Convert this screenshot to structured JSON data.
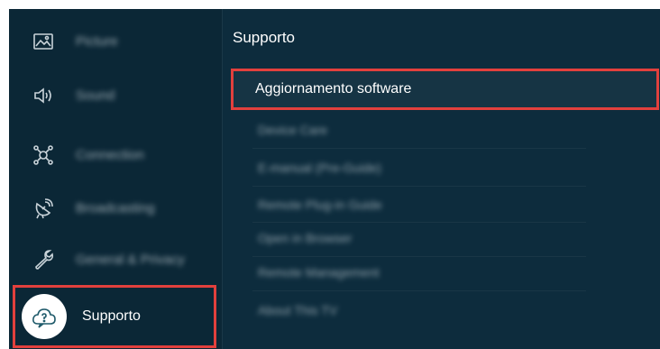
{
  "sidebar": {
    "items": [
      {
        "label": "Picture",
        "icon": "picture-icon"
      },
      {
        "label": "Sound",
        "icon": "speaker-icon"
      },
      {
        "label": "Connection",
        "icon": "network-icon"
      },
      {
        "label": "Broadcasting",
        "icon": "satellite-icon"
      },
      {
        "label": "General & Privacy",
        "icon": "wrench-icon"
      },
      {
        "label": "Supporto",
        "icon": "support-cloud-icon"
      }
    ],
    "selected_index": 5
  },
  "panel": {
    "title": "Supporto",
    "highlighted": "Aggiornamento software",
    "items": [
      {
        "label": "Device Care"
      },
      {
        "label": "E-manual (Pre-Guide)"
      },
      {
        "label": "Remote Plug-in Guide"
      },
      {
        "label": "Open in Browser"
      },
      {
        "label": "Remote Management"
      },
      {
        "label": "About This TV"
      }
    ]
  },
  "colors": {
    "background": "#0d2c3d",
    "sidebar": "#0b2736",
    "highlight_border": "#e2403d",
    "text": "#ffffff"
  }
}
